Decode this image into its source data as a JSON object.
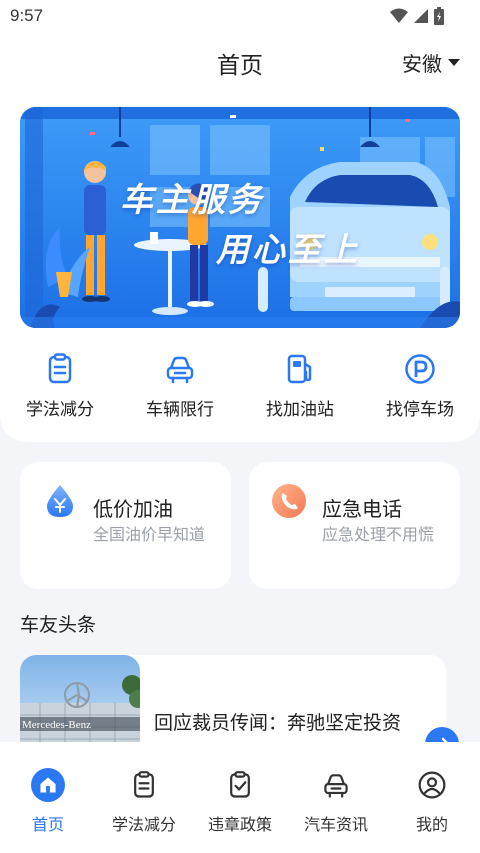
{
  "status": {
    "time": "9:57"
  },
  "header": {
    "title": "首页",
    "region": "安徽"
  },
  "banner": {
    "line1": "车主服务",
    "line2": "用心至上"
  },
  "quick_nav": [
    {
      "label": "学法减分",
      "icon": "clipboard-icon"
    },
    {
      "label": "车辆限行",
      "icon": "car-icon"
    },
    {
      "label": "找加油站",
      "icon": "fuel-station-icon"
    },
    {
      "label": "找停车场",
      "icon": "parking-icon"
    }
  ],
  "cards": [
    {
      "title": "低价加油",
      "subtitle": "全国油价早知道",
      "icon": "oil-drop-icon"
    },
    {
      "title": "应急电话",
      "subtitle": "应急处理不用慌",
      "icon": "phone-icon"
    }
  ],
  "news_section": {
    "title": "车友头条"
  },
  "news": [
    {
      "title": "回应裁员传闻：奔驰坚定投资",
      "thumb_text": "Mercedes-Benz"
    }
  ],
  "bottom_nav": [
    {
      "label": "首页",
      "icon": "home-icon",
      "active": true
    },
    {
      "label": "学法减分",
      "icon": "clipboard-icon",
      "active": false
    },
    {
      "label": "违章政策",
      "icon": "clipboard-check-icon",
      "active": false
    },
    {
      "label": "汽车资讯",
      "icon": "car-icon",
      "active": false
    },
    {
      "label": "我的",
      "icon": "user-icon",
      "active": false
    }
  ],
  "colors": {
    "accent": "#2b78f5",
    "background": "#f3f5f9",
    "card": "#ffffff",
    "muted_text": "#9aa0a8"
  }
}
